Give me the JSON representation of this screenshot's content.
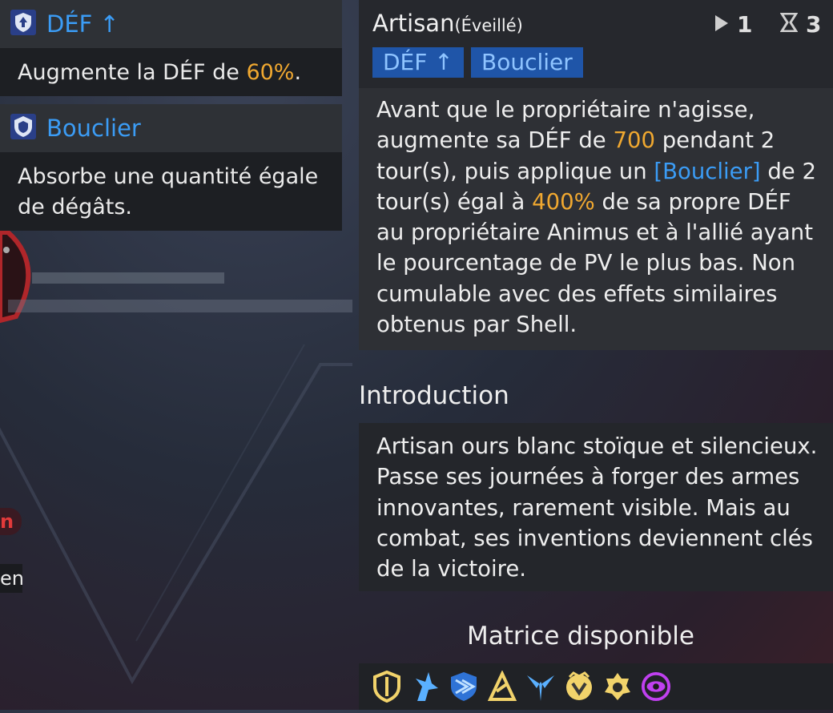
{
  "colors": {
    "accent": "#3b9cf5",
    "highlight": "#f0a830",
    "tag_bg": "#1f55a8"
  },
  "left_tooltips": [
    {
      "icon": "def-up-icon",
      "title": "DÉF ↑",
      "desc_pre": "Augmente la DÉF de ",
      "desc_value": "60%",
      "desc_post": "."
    },
    {
      "icon": "shield-icon",
      "title": "Bouclier",
      "desc": "Absorbe une quantité égale de dégâts."
    }
  ],
  "header": {
    "name": "Artisan",
    "state": "(Éveillé)",
    "cost": "1",
    "cooldown": "3",
    "tags": [
      "DÉF ↑",
      "Bouclier"
    ]
  },
  "skill_desc": {
    "p1": "Avant que le propriétaire n'agisse, augmente sa DÉF de ",
    "v1": "700",
    "p2": " pendant 2 tour(s), puis applique un ",
    "link": "[Bouclier]",
    "p3": " de 2 tour(s) égal à ",
    "v2": "400%",
    "p4": " de sa propre DÉF au propriétaire Animus et à l'allié ayant le pourcentage de PV le plus bas. Non cumulable avec des effets similaires obtenus par Shell."
  },
  "intro": {
    "heading": "Introduction",
    "text": "Artisan ours blanc stoïque et silencieux. Passe ses journées à forger des armes innovantes, rarement visible. Mais au combat, ses inventions deviennent clés de la victoire."
  },
  "matrix": {
    "heading": "Matrice disponible",
    "icons": [
      "gold-shield-icon",
      "blue-claw-icon",
      "blue-stripe-shield-icon",
      "gold-triangle-icon",
      "blue-wings-icon",
      "gold-crest-icon",
      "gold-gear-icon",
      "purple-eye-icon"
    ]
  },
  "side": {
    "badge": "n",
    "label": "en"
  }
}
